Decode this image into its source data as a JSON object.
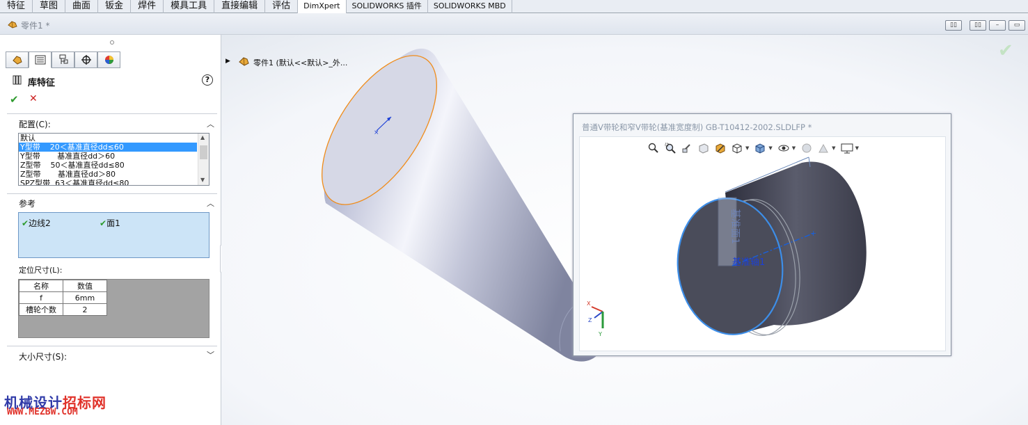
{
  "menu_tabs": [
    "特征",
    "草图",
    "曲面",
    "钣金",
    "焊件",
    "模具工具",
    "直接编辑",
    "评估",
    "DimXpert",
    "SOLIDWORKS 插件",
    "SOLIDWORKS MBD"
  ],
  "document": {
    "title": "零件1 *"
  },
  "feature_panel": {
    "title": "库特征",
    "help": "?",
    "config": {
      "label": "配置(C):",
      "items": [
        "默认",
        "Y型带    20＜基准直径dd≤60",
        "Y型带       基准直径dd＞60",
        "Z型带    50＜基准直径dd≤80",
        "Z型带       基准直径dd＞80",
        "SPZ型带  63＜基准直径dd≤80"
      ],
      "selected_index": 1
    },
    "references": {
      "label": "参考",
      "items": [
        "边线2",
        "面1"
      ]
    },
    "locating_dims": {
      "label": "定位尺寸(L):",
      "headers": [
        "名称",
        "数值"
      ],
      "rows": [
        [
          "f",
          "6mm"
        ],
        [
          "槽轮个数",
          "2"
        ]
      ]
    },
    "size_dims": {
      "label": "大小尺寸(S):"
    }
  },
  "tree": {
    "root_label": "零件1  (默认<<默认>_外..."
  },
  "preview": {
    "title": "普通V带轮和窄V带轮(基准宽度制) GB-T10412-2002.SLDLFP *",
    "axis_label": "基准轴1",
    "face_label": "基准面1",
    "triad": [
      "X",
      "Z",
      "Y"
    ]
  },
  "watermark": {
    "cn_blue": "机械设计",
    "cn_red": "招标网",
    "url": "WWW.MEZBW.COM"
  },
  "colors": {
    "selection": "#3399ff",
    "ref_box": "#cce4f7",
    "edge_highlight": "#f08c1a",
    "accent_blue": "#1b5fd6"
  }
}
